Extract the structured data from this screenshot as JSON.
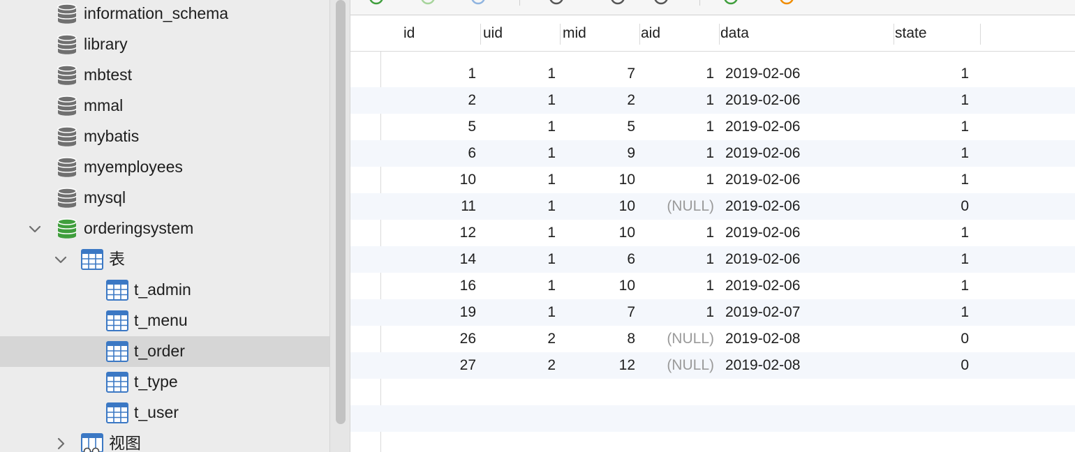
{
  "sidebar": {
    "databases": [
      {
        "name": "information_schema"
      },
      {
        "name": "library"
      },
      {
        "name": "mbtest"
      },
      {
        "name": "mmal"
      },
      {
        "name": "mybatis"
      },
      {
        "name": "myemployees"
      },
      {
        "name": "mysql"
      },
      {
        "name": "orderingsystem",
        "expanded": true,
        "active": true
      }
    ],
    "tables_group_label": "表",
    "tables": [
      "t_admin",
      "t_menu",
      "t_order",
      "t_type",
      "t_user"
    ],
    "selected_table": "t_order",
    "views_group_label": "视图",
    "colors": {
      "db_inactive": "#707070",
      "db_active": "#3f9e3c",
      "table_icon": "#3b78c4",
      "selection": "#d6d6d6"
    }
  },
  "grid": {
    "columns": [
      "id",
      "uid",
      "mid",
      "aid",
      "data",
      "state"
    ],
    "rows": [
      [
        "1",
        "1",
        "7",
        "1",
        "2019-02-06",
        "1"
      ],
      [
        "2",
        "1",
        "2",
        "1",
        "2019-02-06",
        "1"
      ],
      [
        "5",
        "1",
        "5",
        "1",
        "2019-02-06",
        "1"
      ],
      [
        "6",
        "1",
        "9",
        "1",
        "2019-02-06",
        "1"
      ],
      [
        "10",
        "1",
        "10",
        "1",
        "2019-02-06",
        "1"
      ],
      [
        "11",
        "1",
        "10",
        "(NULL)",
        "2019-02-06",
        "0"
      ],
      [
        "12",
        "1",
        "10",
        "1",
        "2019-02-06",
        "1"
      ],
      [
        "14",
        "1",
        "6",
        "1",
        "2019-02-06",
        "1"
      ],
      [
        "16",
        "1",
        "10",
        "1",
        "2019-02-06",
        "1"
      ],
      [
        "19",
        "1",
        "7",
        "1",
        "2019-02-07",
        "1"
      ],
      [
        "26",
        "2",
        "8",
        "(NULL)",
        "2019-02-08",
        "0"
      ],
      [
        "27",
        "2",
        "12",
        "(NULL)",
        "2019-02-08",
        "0"
      ]
    ],
    "colors": {
      "alt_row": "#f4f7fc",
      "null_text": "#9a9a9a"
    }
  },
  "toolbar": {
    "icons": [
      "refresh-green-icon",
      "refresh-lightgreen-icon",
      "refresh-blue-icon",
      "form-view-icon",
      "play-icon",
      "filter-icon",
      "import-icon",
      "export-icon"
    ]
  }
}
